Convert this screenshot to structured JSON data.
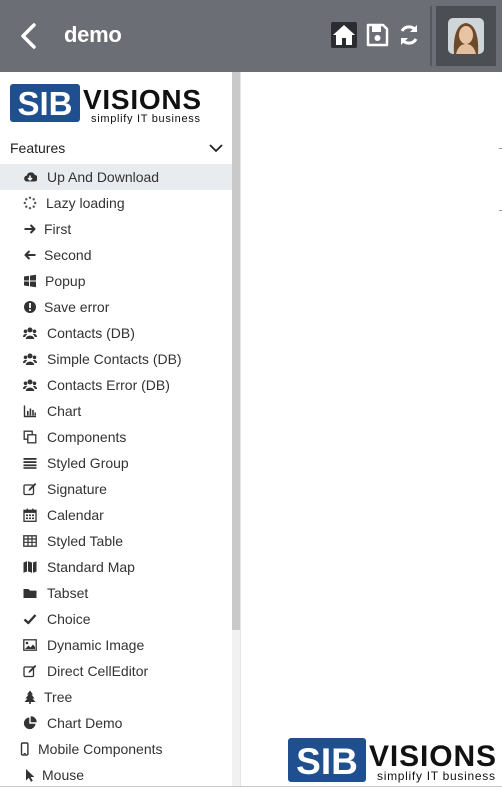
{
  "header": {
    "title": "demo",
    "back_icon": "chevron-left-icon",
    "toolbar_icons": [
      "home-icon",
      "save-icon",
      "refresh-icon"
    ],
    "avatar_icon": "user-avatar"
  },
  "logo": {
    "brand_left": "SIB",
    "brand_right": "VISIONS",
    "tagline": "simplify IT business"
  },
  "sidebar": {
    "section_label": "Features",
    "items": [
      {
        "label": "Up And Download",
        "icon": "cloud-download-icon",
        "active": true
      },
      {
        "label": "Lazy loading",
        "icon": "spinner-icon"
      },
      {
        "label": "First",
        "icon": "arrow-right-icon"
      },
      {
        "label": "Second",
        "icon": "arrow-left-icon"
      },
      {
        "label": "Popup",
        "icon": "windows-icon"
      },
      {
        "label": "Save error",
        "icon": "exclamation-circle-icon"
      },
      {
        "label": "Contacts (DB)",
        "icon": "users-icon"
      },
      {
        "label": "Simple Contacts (DB)",
        "icon": "users-icon"
      },
      {
        "label": "Contacts Error (DB)",
        "icon": "users-icon"
      },
      {
        "label": "Chart",
        "icon": "bar-chart-icon"
      },
      {
        "label": "Components",
        "icon": "clone-icon"
      },
      {
        "label": "Styled Group",
        "icon": "list-lines-icon"
      },
      {
        "label": "Signature",
        "icon": "edit-icon"
      },
      {
        "label": "Calendar",
        "icon": "calendar-icon"
      },
      {
        "label": "Styled Table",
        "icon": "table-icon"
      },
      {
        "label": "Standard Map",
        "icon": "map-icon"
      },
      {
        "label": "Tabset",
        "icon": "folder-icon"
      },
      {
        "label": "Choice",
        "icon": "check-icon"
      },
      {
        "label": "Dynamic Image",
        "icon": "image-icon"
      },
      {
        "label": "Direct CellEditor",
        "icon": "edit-icon"
      },
      {
        "label": "Tree",
        "icon": "tree-icon"
      },
      {
        "label": "Chart Demo",
        "icon": "pie-chart-icon"
      },
      {
        "label": "Mobile Components",
        "icon": "mobile-icon"
      },
      {
        "label": "Mouse",
        "icon": "mouse-pointer-icon"
      }
    ]
  },
  "colors": {
    "header_bg": "#6b6e74",
    "brand_blue": "#1f4f8f",
    "active_row": "#e9ecef"
  }
}
